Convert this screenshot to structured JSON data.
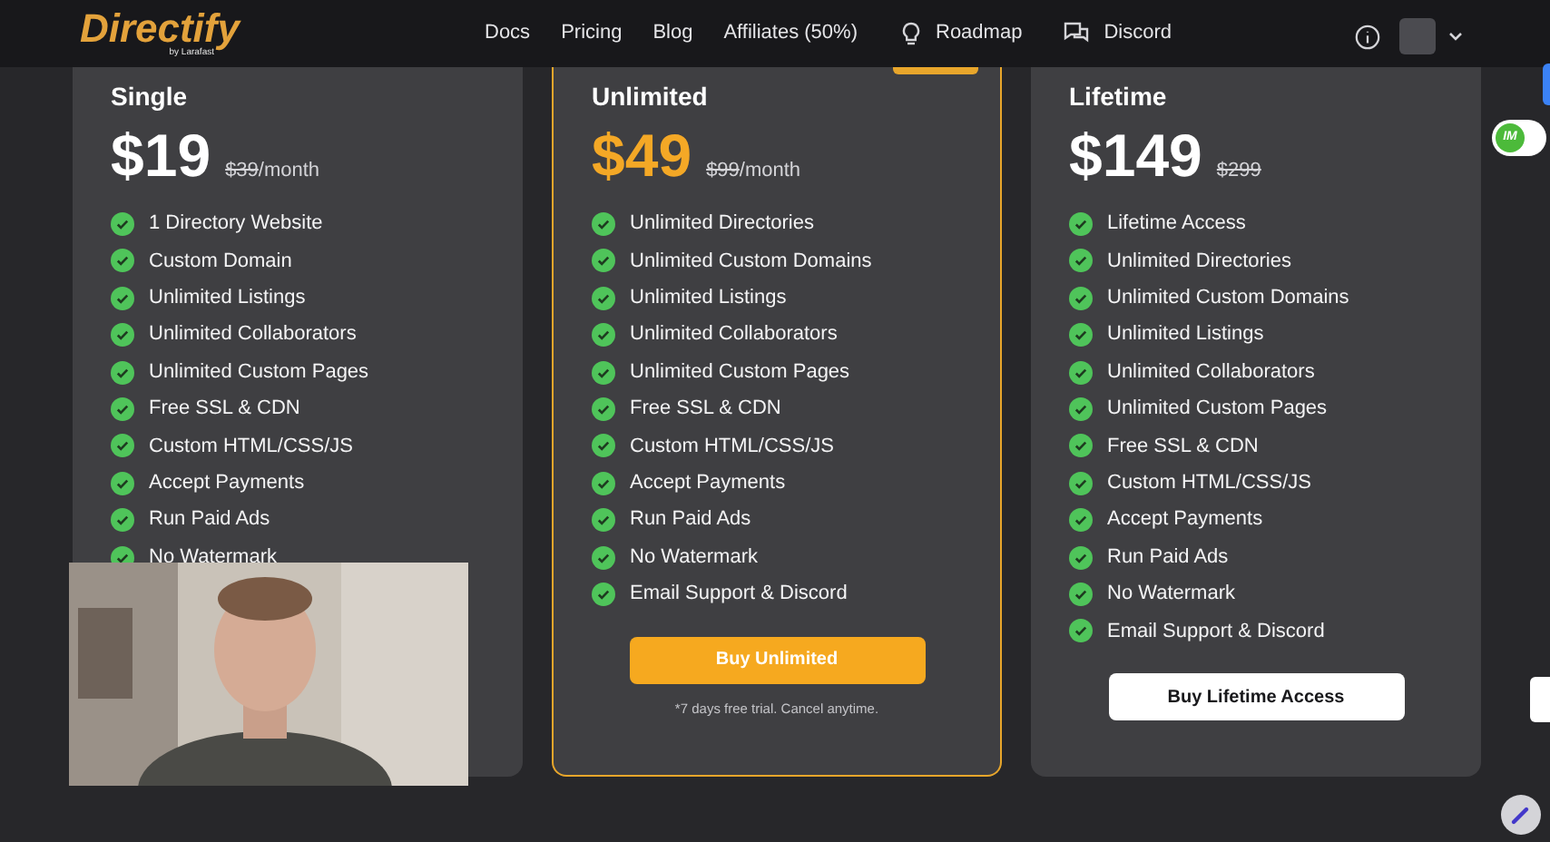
{
  "brand": {
    "name": "Directify",
    "tagline": "by Larafast"
  },
  "nav": [
    {
      "label": "Docs",
      "kind": "text"
    },
    {
      "label": "Pricing",
      "kind": "text"
    },
    {
      "label": "Blog",
      "kind": "text"
    },
    {
      "label": "Affiliates (50%)",
      "kind": "text"
    },
    {
      "label": "Roadmap",
      "kind": "bulb"
    },
    {
      "label": "Discord",
      "kind": "chat"
    }
  ],
  "plans": [
    {
      "name": "Single",
      "price": "$19",
      "old_price": "$39",
      "period": "/month",
      "highlighted": false,
      "features": [
        "1 Directory Website",
        "Custom Domain",
        "Unlimited Listings",
        "Unlimited Collaborators",
        "Unlimited Custom Pages",
        "Free SSL & CDN",
        "Custom HTML/CSS/JS",
        "Accept Payments",
        "Run Paid Ads",
        "No Watermark"
      ]
    },
    {
      "name": "Unlimited",
      "price": "$49",
      "old_price": "$99",
      "period": "/month",
      "highlighted": true,
      "features": [
        "Unlimited Directories",
        "Unlimited Custom Domains",
        "Unlimited Listings",
        "Unlimited Collaborators",
        "Unlimited Custom Pages",
        "Free SSL & CDN",
        "Custom HTML/CSS/JS",
        "Accept Payments",
        "Run Paid Ads",
        "No Watermark",
        "Email Support & Discord"
      ],
      "button": "Buy Unlimited",
      "note": "*7 days free trial. Cancel anytime."
    },
    {
      "name": "Lifetime",
      "price": "$149",
      "old_price": "$299",
      "highlighted": false,
      "features": [
        "Lifetime Access",
        "Unlimited Directories",
        "Unlimited Custom Domains",
        "Unlimited Listings",
        "Unlimited Collaborators",
        "Unlimited Custom Pages",
        "Free SSL & CDN",
        "Custom HTML/CSS/JS",
        "Accept Payments",
        "Run Paid Ads",
        "No Watermark",
        "Email Support & Discord"
      ],
      "button": "Buy Lifetime Access"
    }
  ],
  "extension_badge": "IM"
}
